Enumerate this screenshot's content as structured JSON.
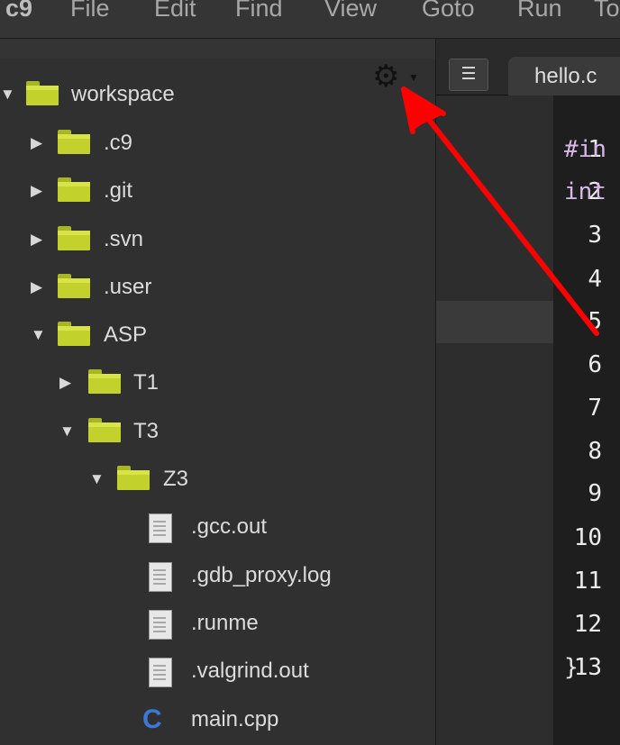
{
  "menubar": {
    "logo": "c9",
    "items": [
      "File",
      "Edit",
      "Find",
      "View",
      "Goto",
      "Run",
      "To"
    ]
  },
  "sidebar": {
    "tree": [
      {
        "label": "workspace",
        "type": "folder",
        "expanded": true
      },
      {
        "label": ".c9",
        "type": "folder",
        "expanded": false
      },
      {
        "label": ".git",
        "type": "folder",
        "expanded": false
      },
      {
        "label": ".svn",
        "type": "folder",
        "expanded": false
      },
      {
        "label": ".user",
        "type": "folder",
        "expanded": false
      },
      {
        "label": "ASP",
        "type": "folder",
        "expanded": true
      },
      {
        "label": "T1",
        "type": "folder",
        "expanded": false
      },
      {
        "label": "T3",
        "type": "folder",
        "expanded": true
      },
      {
        "label": "Z3",
        "type": "folder",
        "expanded": true
      },
      {
        "label": ".gcc.out",
        "type": "file"
      },
      {
        "label": ".gdb_proxy.log",
        "type": "file"
      },
      {
        "label": ".runme",
        "type": "file"
      },
      {
        "label": ".valgrind.out",
        "type": "file"
      },
      {
        "label": "main.cpp",
        "type": "cpp"
      }
    ],
    "settings_icon": "gear-icon"
  },
  "editor": {
    "tab_list_icon": "tab-list-icon",
    "active_tab": "hello.c",
    "line_numbers": [
      "1",
      "2",
      "3",
      "4",
      "5",
      "6",
      "7",
      "8",
      "9",
      "10",
      "11",
      "12",
      "13"
    ],
    "active_line": "5",
    "code_lines": [
      {
        "line": "1",
        "text": "#in"
      },
      {
        "line": "2",
        "text": "int"
      },
      {
        "line": "13",
        "text": "}"
      }
    ]
  },
  "colors": {
    "folder": "#c3d12d",
    "annotation_arrow": "#ff0000",
    "editor_background": "#1e1e1e"
  }
}
